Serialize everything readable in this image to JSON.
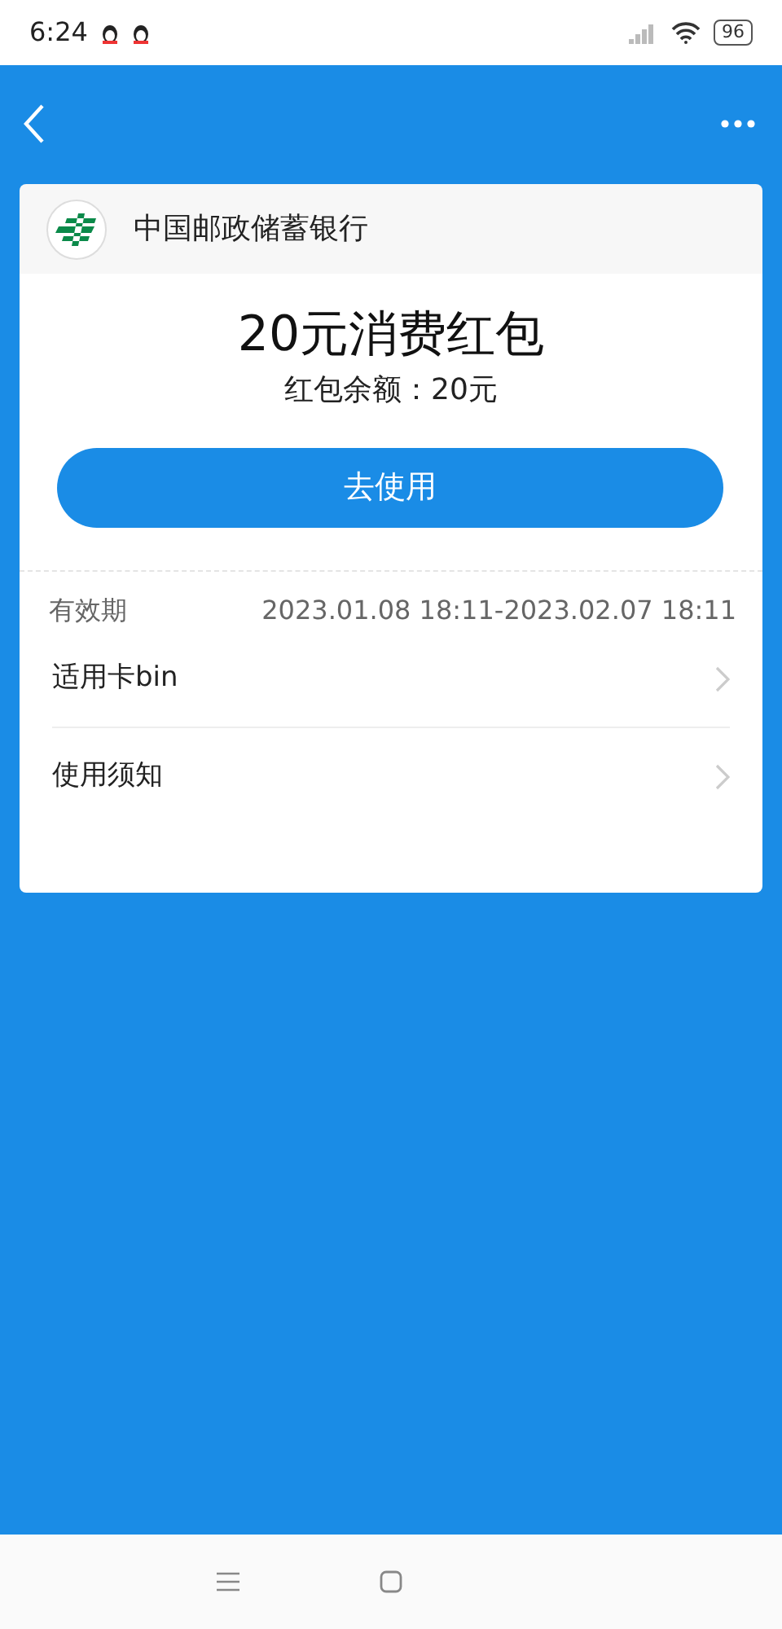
{
  "status_bar": {
    "time": "6:24",
    "battery": "96"
  },
  "bank": {
    "name": "中国邮政储蓄银行"
  },
  "coupon": {
    "title": "20元消费红包",
    "balance_label": "红包余额：",
    "balance": "20元",
    "button": "去使用"
  },
  "validity": {
    "label": "有效期",
    "value": "2023.01.08 18:11-2023.02.07 18:11"
  },
  "rows": [
    {
      "label": "适用卡bin"
    },
    {
      "label": "使用须知"
    }
  ]
}
